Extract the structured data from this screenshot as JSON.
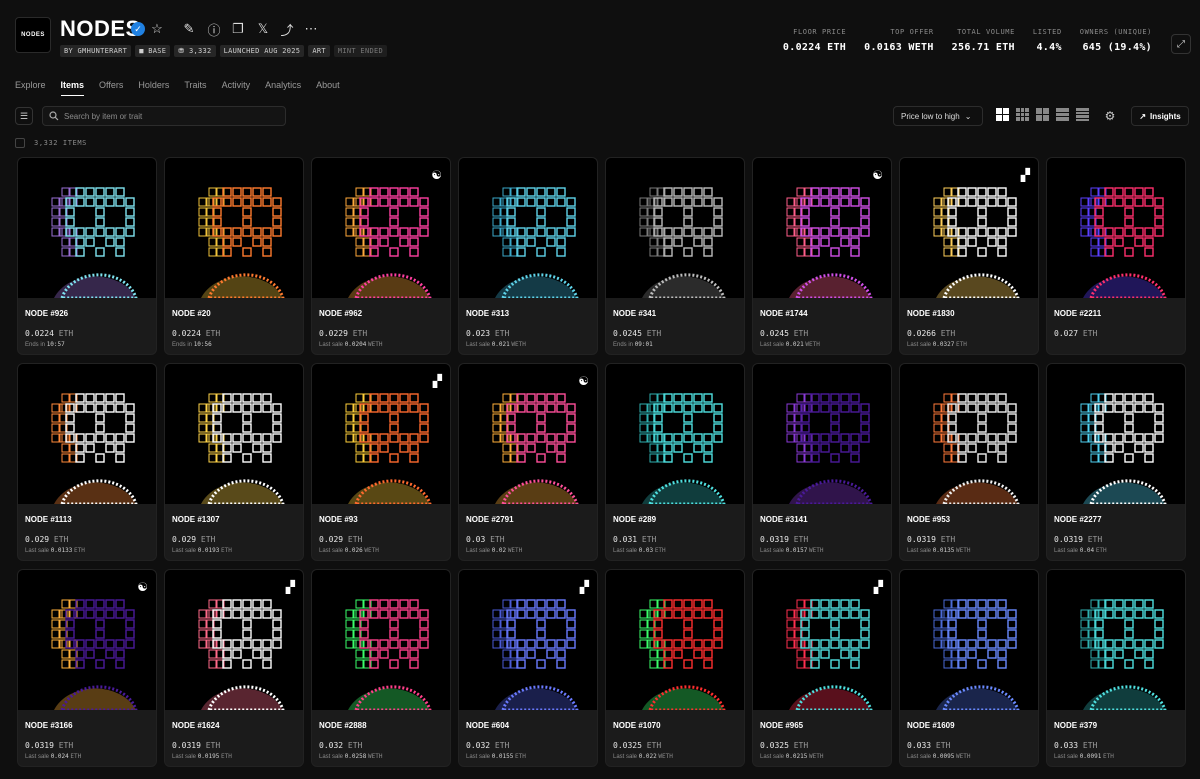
{
  "header": {
    "logo_text": "NODES",
    "title": "NODES",
    "badges": [
      "BY GMHUNTERART",
      "■ BASE",
      "⛃ 3,332",
      "LAUNCHED AUG 2025",
      "ART",
      "MINT ENDED"
    ],
    "stats": [
      {
        "label": "FLOOR PRICE",
        "value": "0.0224 ETH"
      },
      {
        "label": "TOP OFFER",
        "value": "0.0163 WETH"
      },
      {
        "label": "TOTAL VOLUME",
        "value": "256.71 ETH"
      },
      {
        "label": "LISTED",
        "value": "4.4%"
      },
      {
        "label": "OWNERS (UNIQUE)",
        "value": "645 (19.4%)"
      }
    ]
  },
  "nav": {
    "tabs": [
      "Explore",
      "Items",
      "Offers",
      "Holders",
      "Traits",
      "Activity",
      "Analytics",
      "About"
    ],
    "active": "Items"
  },
  "toolbar": {
    "search_placeholder": "Search by item or trait",
    "sort_label": "Price low to high",
    "insights_label": "Insights",
    "item_count": "3,332 ITEMS"
  },
  "items": [
    {
      "name": "NODE #926",
      "price": "0.0224",
      "unit": "ETH",
      "sub_prefix": "Ends in",
      "sub_value": "10:57",
      "sub_unit": "",
      "tag": "",
      "palette": [
        "#7fe3f0",
        "#9a6fd6"
      ]
    },
    {
      "name": "NODE #20",
      "price": "0.0224",
      "unit": "ETH",
      "sub_prefix": "Ends in",
      "sub_value": "10:56",
      "sub_unit": "",
      "tag": "",
      "palette": [
        "#ff7a2e",
        "#f0c23a"
      ]
    },
    {
      "name": "NODE #962",
      "price": "0.0229",
      "unit": "ETH",
      "sub_prefix": "Last sale",
      "sub_value": "0.0204",
      "sub_unit": "WETH",
      "tag": "yin",
      "palette": [
        "#ff3fa0",
        "#ffa93a"
      ]
    },
    {
      "name": "NODE #313",
      "price": "0.023",
      "unit": "ETH",
      "sub_prefix": "Last sale",
      "sub_value": "0.021",
      "sub_unit": "WETH",
      "tag": "",
      "palette": [
        "#5fd4ea",
        "#3aa7c9"
      ]
    },
    {
      "name": "NODE #341",
      "price": "0.0245",
      "unit": "ETH",
      "sub_prefix": "Ends in",
      "sub_value": "09:01",
      "sub_unit": "",
      "tag": "",
      "palette": [
        "#bdbdbd",
        "#7a7a7a"
      ]
    },
    {
      "name": "NODE #1744",
      "price": "0.0245",
      "unit": "ETH",
      "sub_prefix": "Last sale",
      "sub_value": "0.021",
      "sub_unit": "WETH",
      "tag": "yin",
      "palette": [
        "#d24fe8",
        "#ff5e8a"
      ]
    },
    {
      "name": "NODE #1830",
      "price": "0.0266",
      "unit": "ETH",
      "sub_prefix": "Last sale",
      "sub_value": "0.0327",
      "sub_unit": "ETH",
      "tag": "tetris",
      "palette": [
        "#ffffff",
        "#ffcf5a"
      ]
    },
    {
      "name": "NODE #2211",
      "price": "0.027",
      "unit": "ETH",
      "sub_prefix": "",
      "sub_value": "",
      "sub_unit": "",
      "tag": "",
      "palette": [
        "#ff2f6d",
        "#5b3fff"
      ]
    },
    {
      "name": "NODE #1113",
      "price": "0.029",
      "unit": "ETH",
      "sub_prefix": "Last sale",
      "sub_value": "0.0133",
      "sub_unit": "ETH",
      "tag": "",
      "palette": [
        "#ffffff",
        "#ff8a3a"
      ]
    },
    {
      "name": "NODE #1307",
      "price": "0.029",
      "unit": "ETH",
      "sub_prefix": "Last sale",
      "sub_value": "0.0193",
      "sub_unit": "ETH",
      "tag": "",
      "palette": [
        "#ffffff",
        "#ffd54a"
      ]
    },
    {
      "name": "NODE #93",
      "price": "0.029",
      "unit": "ETH",
      "sub_prefix": "Last sale",
      "sub_value": "0.026",
      "sub_unit": "WETH",
      "tag": "tetris",
      "palette": [
        "#ff6a2e",
        "#ffcf3a"
      ]
    },
    {
      "name": "NODE #2791",
      "price": "0.03",
      "unit": "ETH",
      "sub_prefix": "Last sale",
      "sub_value": "0.02",
      "sub_unit": "WETH",
      "tag": "yin",
      "palette": [
        "#ff4f9a",
        "#ffb03a"
      ]
    },
    {
      "name": "NODE #289",
      "price": "0.031",
      "unit": "ETH",
      "sub_prefix": "Last sale",
      "sub_value": "0.03",
      "sub_unit": "ETH",
      "tag": "",
      "palette": [
        "#4fe0e0",
        "#2fb0b0"
      ]
    },
    {
      "name": "NODE #3141",
      "price": "0.0319",
      "unit": "ETH",
      "sub_prefix": "Last sale",
      "sub_value": "0.0157",
      "sub_unit": "WETH",
      "tag": "",
      "palette": [
        "#4a1a9a",
        "#8a3ad6"
      ]
    },
    {
      "name": "NODE #953",
      "price": "0.0319",
      "unit": "ETH",
      "sub_prefix": "Last sale",
      "sub_value": "0.0135",
      "sub_unit": "WETH",
      "tag": "",
      "palette": [
        "#f0f0f0",
        "#ff7a3a"
      ]
    },
    {
      "name": "NODE #2277",
      "price": "0.0319",
      "unit": "ETH",
      "sub_prefix": "Last sale",
      "sub_value": "0.04",
      "sub_unit": "ETH",
      "tag": "",
      "palette": [
        "#ffffff",
        "#4fd0f0"
      ]
    },
    {
      "name": "NODE #3166",
      "price": "0.0319",
      "unit": "ETH",
      "sub_prefix": "Last sale",
      "sub_value": "0.024",
      "sub_unit": "ETH",
      "tag": "yin",
      "palette": [
        "#4a1a9a",
        "#ffb03a"
      ]
    },
    {
      "name": "NODE #1624",
      "price": "0.0319",
      "unit": "ETH",
      "sub_prefix": "Last sale",
      "sub_value": "0.0195",
      "sub_unit": "ETH",
      "tag": "tetris",
      "palette": [
        "#ffffff",
        "#ff6a8a"
      ]
    },
    {
      "name": "NODE #2888",
      "price": "0.032",
      "unit": "ETH",
      "sub_prefix": "Last sale",
      "sub_value": "0.0258",
      "sub_unit": "WETH",
      "tag": "",
      "palette": [
        "#ff3f8a",
        "#3aff6a"
      ]
    },
    {
      "name": "NODE #604",
      "price": "0.032",
      "unit": "ETH",
      "sub_prefix": "Last sale",
      "sub_value": "0.0155",
      "sub_unit": "ETH",
      "tag": "tetris",
      "palette": [
        "#6a7aff",
        "#4a5ad6"
      ]
    },
    {
      "name": "NODE #1070",
      "price": "0.0325",
      "unit": "ETH",
      "sub_prefix": "Last sale",
      "sub_value": "0.022",
      "sub_unit": "WETH",
      "tag": "",
      "palette": [
        "#ff2f2f",
        "#3aff6a"
      ]
    },
    {
      "name": "NODE #965",
      "price": "0.0325",
      "unit": "ETH",
      "sub_prefix": "Last sale",
      "sub_value": "0.0215",
      "sub_unit": "WETH",
      "tag": "tetris",
      "palette": [
        "#4fe0e0",
        "#ff2f4f"
      ]
    },
    {
      "name": "NODE #1609",
      "price": "0.033",
      "unit": "ETH",
      "sub_prefix": "Last sale",
      "sub_value": "0.0095",
      "sub_unit": "WETH",
      "tag": "",
      "palette": [
        "#6a8aff",
        "#4a6ad6"
      ]
    },
    {
      "name": "NODE #379",
      "price": "0.033",
      "unit": "ETH",
      "sub_prefix": "Last sale",
      "sub_value": "0.0091",
      "sub_unit": "ETH",
      "tag": "",
      "palette": [
        "#4fe0e0",
        "#2fb0b0"
      ]
    }
  ]
}
